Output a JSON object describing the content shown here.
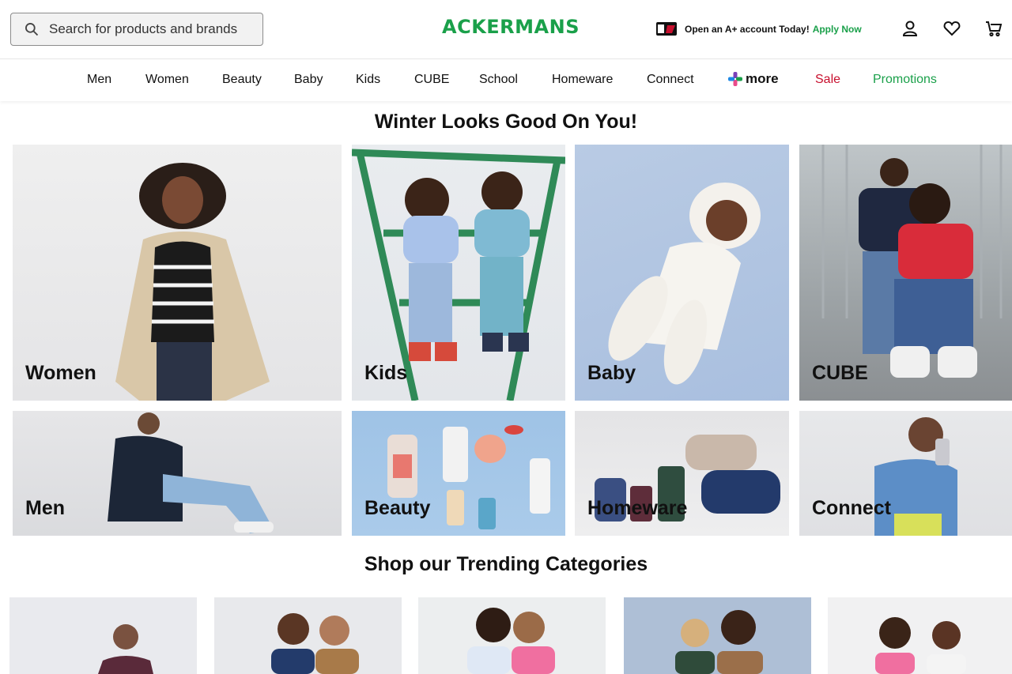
{
  "header": {
    "search_placeholder": "Search for products and brands",
    "logo": "ACKERMANS",
    "promo_text": "Open an A+ account Today!",
    "promo_link": "Apply Now"
  },
  "nav": {
    "items": [
      "Men",
      "Women",
      "Beauty",
      "Baby",
      "Kids",
      "CUBE",
      "School",
      "Homeware",
      "Connect"
    ],
    "more_label": "more",
    "sale_label": "Sale",
    "promotions_label": "Promotions"
  },
  "hero": {
    "title": "Winter Looks Good On You!",
    "tiles": [
      "Women",
      "Kids",
      "Baby",
      "CUBE",
      "Men",
      "Beauty",
      "Homeware",
      "Connect"
    ]
  },
  "trending": {
    "title": "Shop our Trending Categories"
  },
  "colors": {
    "brand": "#1aa04a",
    "sale": "#c8102e",
    "text": "#111111"
  },
  "icons": [
    "search-icon",
    "account-icon",
    "heart-icon",
    "cart-icon",
    "card-icon",
    "more-plus-icon"
  ]
}
